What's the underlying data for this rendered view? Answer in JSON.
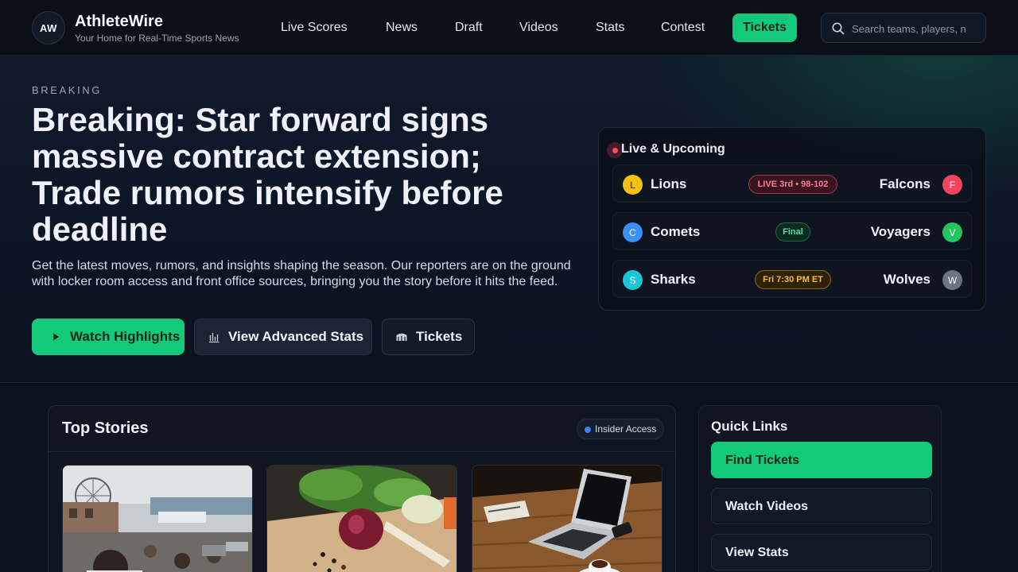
{
  "brand": {
    "logo_initials": "AW",
    "name": "AthleteWire",
    "tagline": "Your Home for Real-Time Sports News"
  },
  "nav": {
    "items": [
      {
        "label": "Live Scores",
        "active": false
      },
      {
        "label": "News",
        "active": false
      },
      {
        "label": "Draft",
        "active": false
      },
      {
        "label": "Videos",
        "active": false
      },
      {
        "label": "Stats",
        "active": false
      },
      {
        "label": "Contest",
        "active": false
      },
      {
        "label": "Tickets",
        "active": true
      }
    ]
  },
  "search": {
    "placeholder": "Search teams, players, n",
    "value": ""
  },
  "hero": {
    "eyebrow": "BREAKING",
    "headline": "Breaking: Star forward signs massive contract extension; Trade rumors intensify before deadline",
    "subhead": "Get the latest moves, rumors, and insights shaping the season. Our reporters are on the ground with locker room access and front office sources, bringing you the story before it hits the feed.",
    "buttons": {
      "highlights": "Watch Highlights",
      "stats": "View Advanced Stats",
      "tickets": "Tickets"
    }
  },
  "live": {
    "title": "Live & Upcoming",
    "games": [
      {
        "home": "Lions",
        "home_initial": "L",
        "home_color": "#f5c211",
        "away": "Falcons",
        "away_initial": "F",
        "away_color": "#f0445f",
        "status": "LIVE 3rd • 98-102",
        "status_type": "live"
      },
      {
        "home": "Comets",
        "home_initial": "C",
        "home_color": "#3b8ff5",
        "away": "Voyagers",
        "away_initial": "V",
        "away_color": "#22c55e",
        "status": "Final",
        "status_type": "final"
      },
      {
        "home": "Sharks",
        "home_initial": "S",
        "home_color": "#19c6d6",
        "away": "Wolves",
        "away_initial": "W",
        "away_color": "#6b7585",
        "status": "Fri 7:30 PM ET",
        "status_type": "upcoming"
      }
    ]
  },
  "stories": {
    "title": "Top Stories",
    "badge": "Insider Access"
  },
  "quick_links": {
    "title": "Quick Links",
    "items": [
      "Find Tickets",
      "Watch Videos",
      "View Stats"
    ]
  },
  "colors": {
    "accent": "#14c97a",
    "background": "#0c1320",
    "live": "#f05067",
    "final": "#4fe0a2",
    "upcoming": "#f6bc3c"
  }
}
